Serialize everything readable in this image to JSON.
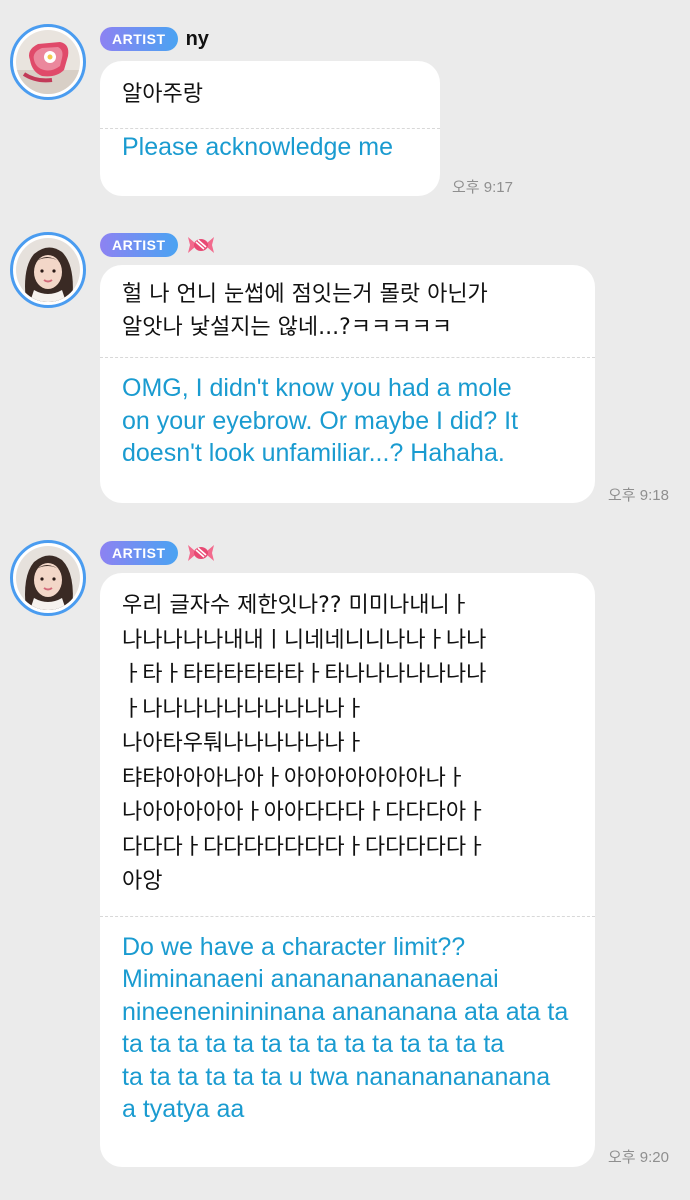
{
  "messages": [
    {
      "badge": "ARTIST",
      "name": "ny",
      "korean": "알아주랑",
      "english": "Please acknowledge me",
      "time": "오후 9:17"
    },
    {
      "badge": "ARTIST",
      "name_icon": "candy-icon",
      "korean": "헐 나 언니 눈썹에 점잇는거 몰랏 아닌가\n알앗나 낯설지는 않네...?ㅋㅋㅋㅋㅋ",
      "english": "OMG, I didn't know you had a mole\non your eyebrow. Or maybe I did? It\ndoesn't look unfamiliar...? Hahaha.",
      "time": "오후 9:18"
    },
    {
      "badge": "ARTIST",
      "name_icon": "candy-icon",
      "korean": "우리 글자수 제한잇나?? 미미나내니ㅏ\n나나나나나내내ㅣ니네네니니나나ㅏ나나\nㅏ타ㅏ타타타타타타ㅏ타나나나나나나나\nㅏ나나나나나나나나나나ㅏ\n나아타우퉈나나나나나나ㅏ\n탸탸아아아나아ㅏ아아아아아아아나ㅏ\n나아아아아아ㅏ아아다다다ㅏ다다다아ㅏ\n다다다ㅏ다다다다다다다ㅏ다다다다다ㅏ\n아앙",
      "english": "Do we have a character limit??\nMiminanaeni ananananananaenai\nnineeneninininana anananana ata ata ta\nta ta ta ta ta ta ta ta ta ta ta ta ta ta\nta ta ta ta ta ta u twa nanananananana\na tyatya aa",
      "time": "오후 9:20"
    }
  ]
}
